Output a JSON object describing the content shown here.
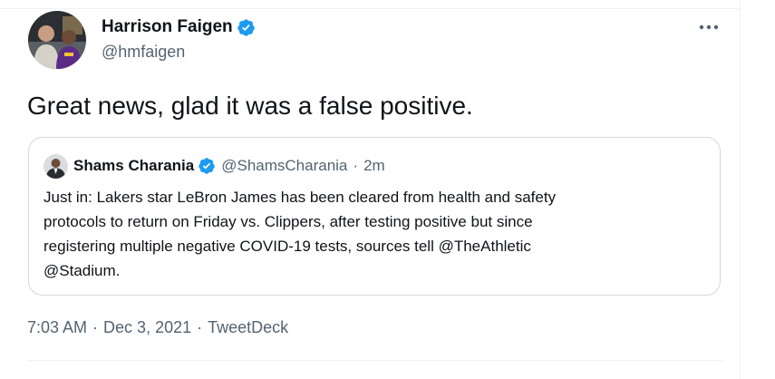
{
  "tweet": {
    "author": {
      "name": "Harrison Faigen",
      "handle": "@hmfaigen",
      "verified": true,
      "avatar_icon": "profile-photo"
    },
    "more_icon": "more-horizontal-icon",
    "text": "Great news, glad it was a false positive.",
    "quote": {
      "author": {
        "name": "Shams Charania",
        "handle": "@ShamsCharania",
        "verified": true,
        "avatar_icon": "profile-photo"
      },
      "separator": "·",
      "time": "2m",
      "lines": [
        "Just in: Lakers star LeBron James has been cleared from health and safety",
        "protocols to return on Friday vs. Clippers, after testing positive but since",
        "registering multiple negative COVID-19 tests, sources tell @TheAthletic",
        "@Stadium."
      ]
    },
    "meta": {
      "time": "7:03 AM",
      "separator": "·",
      "date": "Dec 3, 2021",
      "source": "TweetDeck"
    }
  },
  "colors": {
    "verified_blue": "#1d9bf0",
    "text_primary": "#0f1419",
    "text_secondary": "#536471",
    "border": "#cfd9de"
  }
}
